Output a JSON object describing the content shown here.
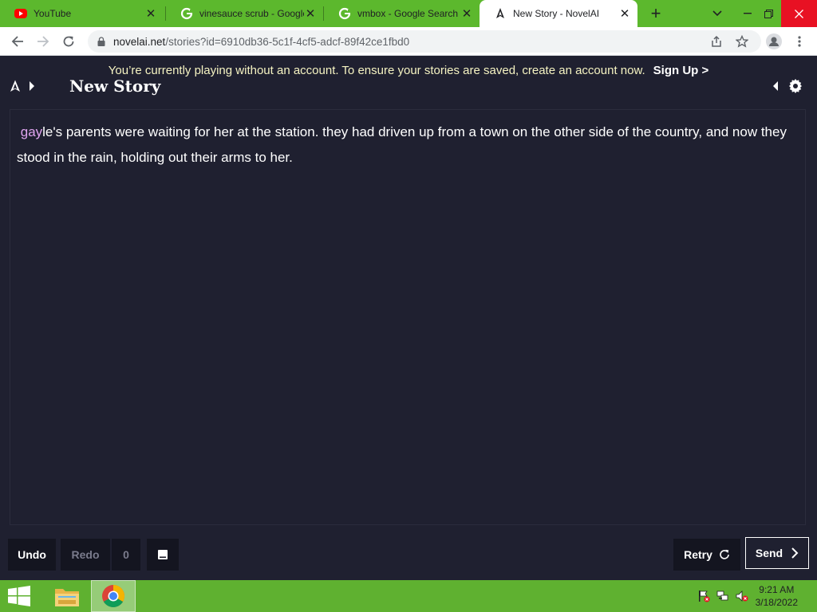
{
  "browser": {
    "tabs": [
      {
        "title": "YouTube",
        "icon": "youtube-icon"
      },
      {
        "title": "vinesauce scrub - Google Search",
        "icon": "google-icon"
      },
      {
        "title": "vmbox - Google Search",
        "icon": "google-icon"
      },
      {
        "title": "New Story - NovelAI",
        "icon": "novelai-icon",
        "active": true
      }
    ],
    "url_host": "novelai.net",
    "url_path": "/stories?id=6910db36-5c1f-4cf5-adcf-89f42ce1fbd0"
  },
  "page": {
    "banner_text": "You’re currently playing without an account. To ensure your stories are saved, create an account now.",
    "banner_link": "Sign Up >",
    "story_title": "New Story",
    "story_highlight": "gay",
    "story_text": "le's parents were waiting for her at the station. they had driven up from a town on the other side of the country, and now they stood in the rain, holding out their arms to her.",
    "controls": {
      "undo": "Undo",
      "redo": "Redo",
      "redo_count": "0",
      "retry": "Retry",
      "send": "Send"
    }
  },
  "taskbar": {
    "time": "9:21 AM",
    "date": "3/18/2022"
  },
  "colors": {
    "tabstrip": "#5cb82d",
    "page_bg": "#1f2030",
    "banner_text": "#f5f3c2",
    "highlight": "#e0a5f0",
    "taskbar": "#5fb130"
  }
}
